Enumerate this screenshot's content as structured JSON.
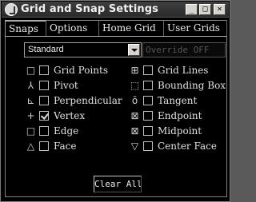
{
  "window": {
    "title": "Grid and Snap Settings",
    "buttons": {
      "minimize": "_",
      "maximize": "□",
      "close": "×"
    }
  },
  "tabs": [
    {
      "label": "Snaps",
      "active": true
    },
    {
      "label": "Options",
      "active": false
    },
    {
      "label": "Home Grid",
      "active": false
    },
    {
      "label": "User Grids",
      "active": false
    }
  ],
  "snaps_panel": {
    "mode_select": {
      "value": "Standard"
    },
    "override_label": "Override OFF",
    "left_column": [
      {
        "label": "Grid Points",
        "icon": "grid-points-icon",
        "glyph": "□",
        "checked": false
      },
      {
        "label": "Pivot",
        "icon": "pivot-icon",
        "glyph": "⅄",
        "checked": false
      },
      {
        "label": "Perpendicular",
        "icon": "perpendicular-icon",
        "glyph": "⊾",
        "checked": false
      },
      {
        "label": "Vertex",
        "icon": "vertex-icon",
        "glyph": "+",
        "checked": true
      },
      {
        "label": "Edge",
        "icon": "edge-icon",
        "glyph": "□",
        "checked": false
      },
      {
        "label": "Face",
        "icon": "face-icon",
        "glyph": "△",
        "checked": false
      }
    ],
    "right_column": [
      {
        "label": "Grid Lines",
        "icon": "grid-lines-icon",
        "glyph": "⊞",
        "checked": false
      },
      {
        "label": "Bounding Box",
        "icon": "bounding-box-icon",
        "glyph": "⬚",
        "checked": false
      },
      {
        "label": "Tangent",
        "icon": "tangent-icon",
        "glyph": "ō",
        "checked": false
      },
      {
        "label": "Endpoint",
        "icon": "endpoint-icon",
        "glyph": "⊠",
        "checked": false
      },
      {
        "label": "Midpoint",
        "icon": "midpoint-icon",
        "glyph": "⊠",
        "checked": false
      },
      {
        "label": "Center Face",
        "icon": "center-face-icon",
        "glyph": "▽",
        "checked": false
      }
    ],
    "clear_all_label": "Clear All"
  }
}
